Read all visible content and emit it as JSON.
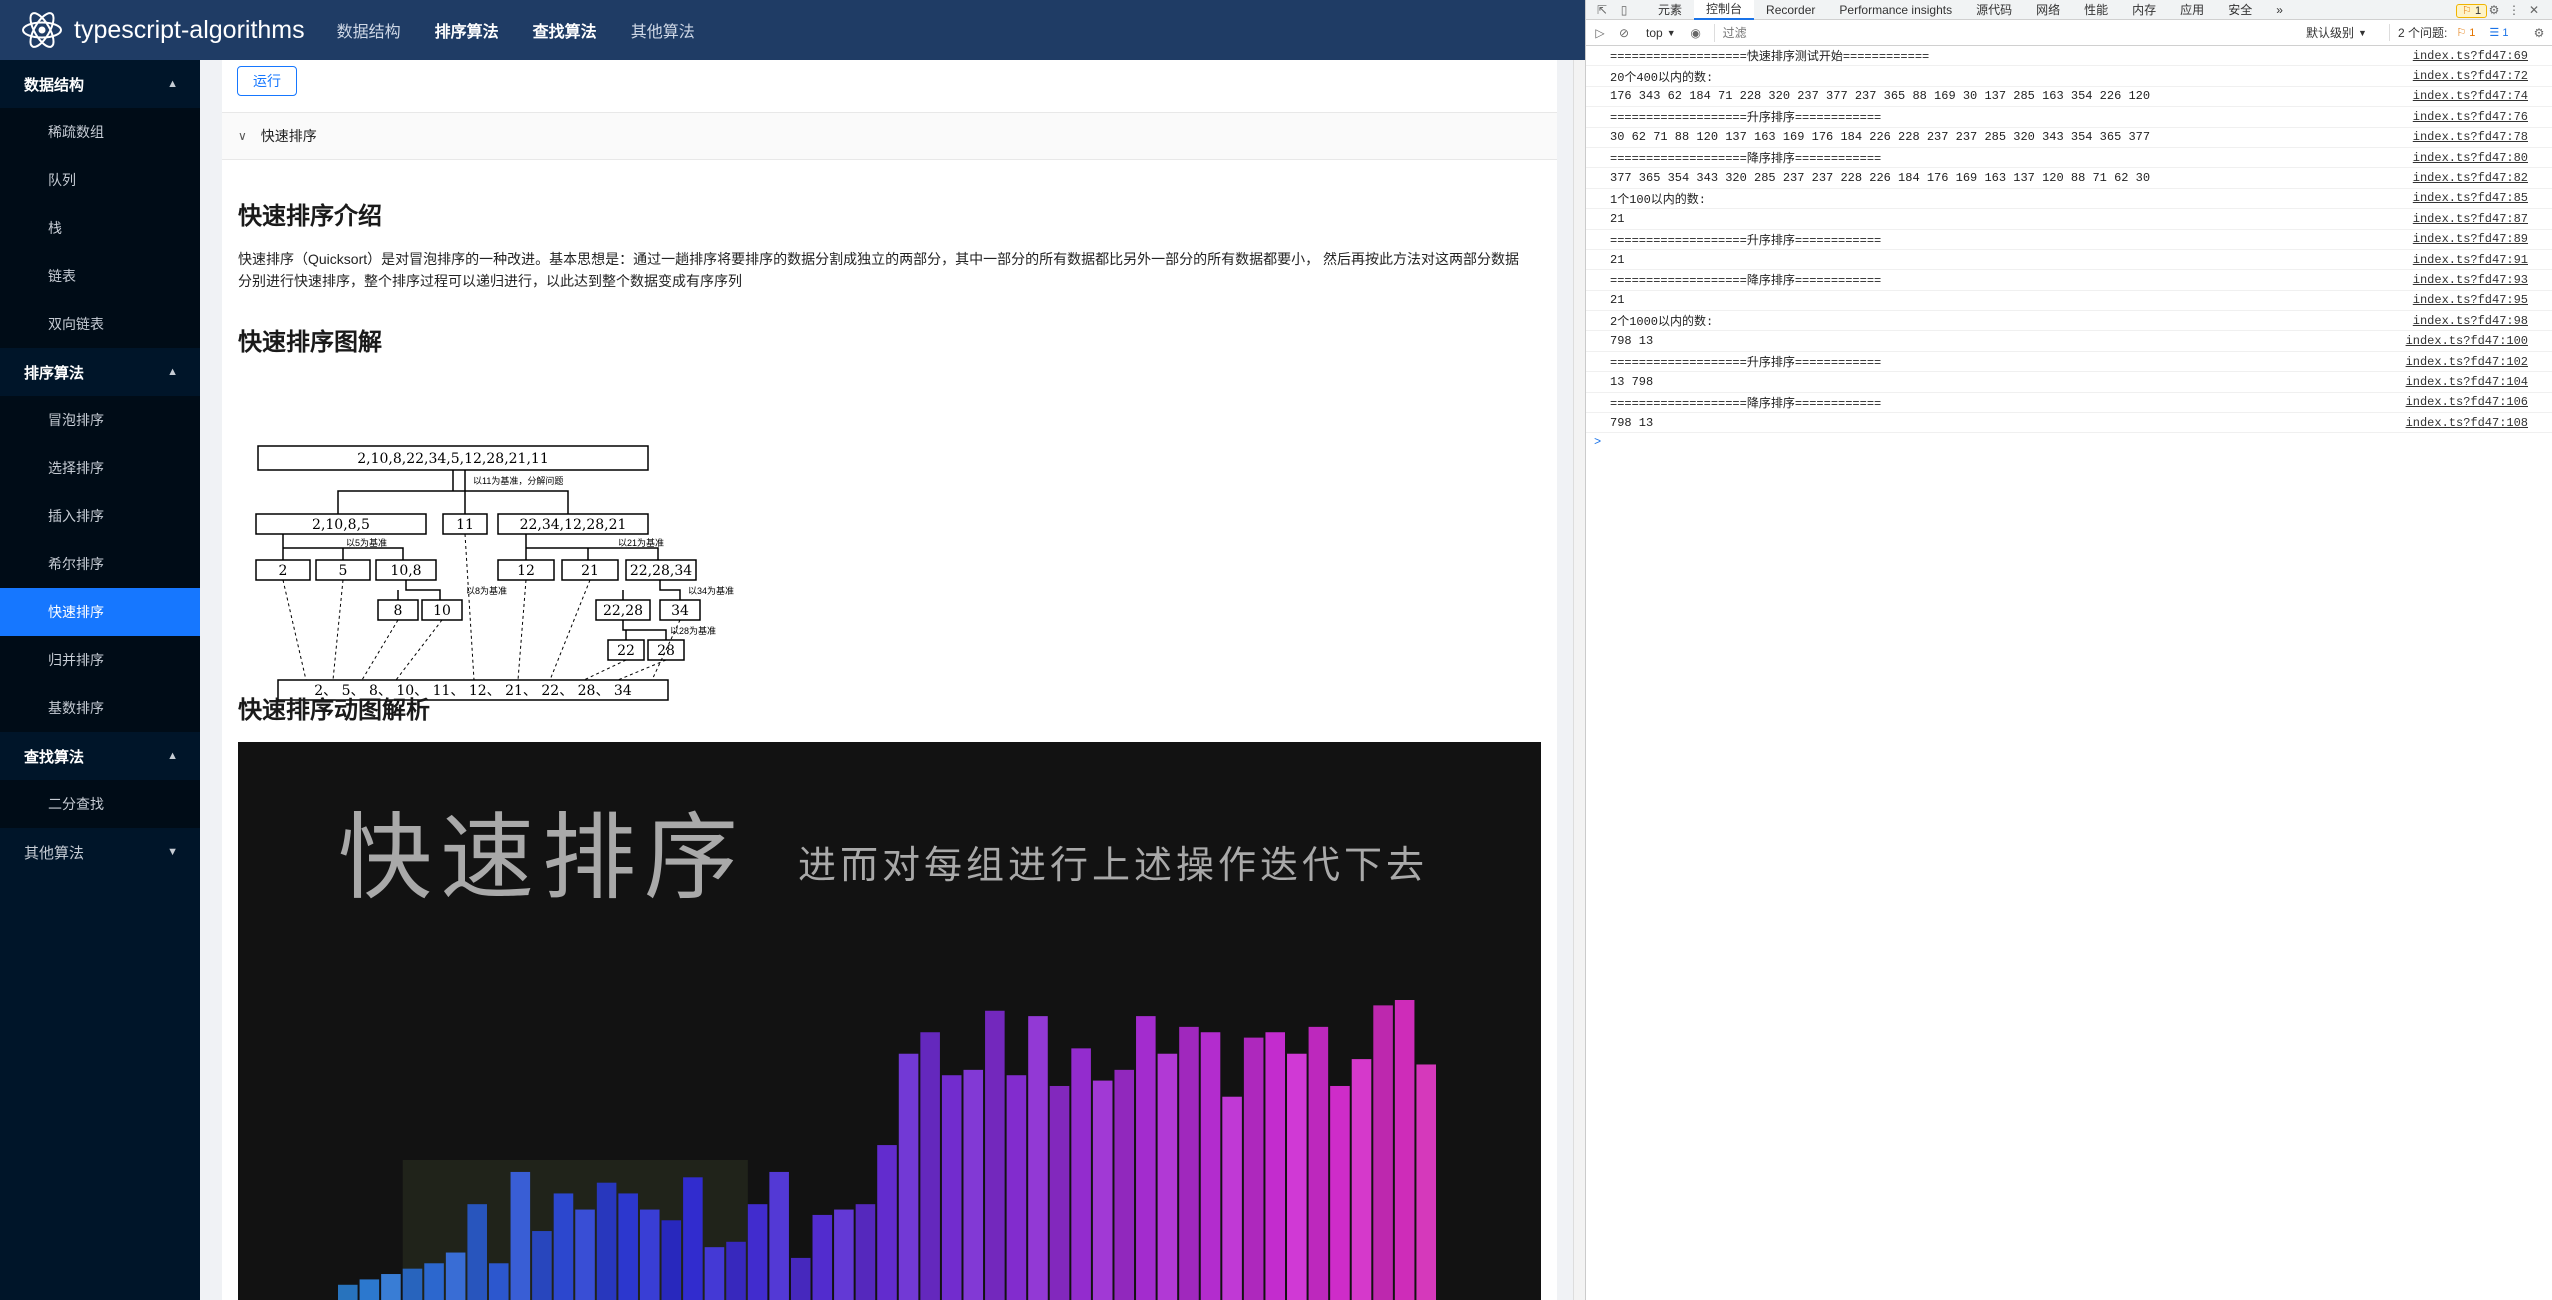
{
  "app": {
    "brand": "typescript-algorithms",
    "menu": [
      "数据结构",
      "排序算法",
      "查找算法",
      "其他算法"
    ]
  },
  "sidebar": {
    "groups": [
      {
        "label": "数据结构",
        "items": [
          "稀疏数组",
          "队列",
          "栈",
          "链表",
          "双向链表"
        ]
      },
      {
        "label": "排序算法",
        "items": [
          "冒泡排序",
          "选择排序",
          "插入排序",
          "希尔排序",
          "快速排序",
          "归并排序",
          "基数排序"
        ]
      },
      {
        "label": "查找算法",
        "items": [
          "二分查找"
        ]
      },
      {
        "label": "其他算法",
        "items": []
      }
    ],
    "active_item": "快速排序"
  },
  "content": {
    "run_button": "运行",
    "collapse_label": "快速排序",
    "intro_heading": "快速排序介绍",
    "intro_text": "快速排序（Quicksort）是对冒泡排序的一种改进。基本思想是：通过一趟排序将要排序的数据分割成独立的两部分，其中一部分的所有数据都比另外一部分的所有数据都要小， 然后再按此方法对这两部分数据分别进行快速排序，整个排序过程可以递归进行，以此达到整个数据变成有序序列",
    "diagram_heading": "快速排序图解",
    "animation_heading": "快速排序动图解析",
    "diagram": {
      "root": "2,10,8,22,34,5,12,28,21,11",
      "note_root": "以11为基准，分解问题",
      "left": "2,10,8,5",
      "pivot": "11",
      "right": "22,34,12,28,21",
      "note_left": "以5为基准",
      "note_right": "以21为基准",
      "l2": [
        "2",
        "5",
        "10,8"
      ],
      "r2": [
        "12",
        "21",
        "22,28,34"
      ],
      "note_8": "以8为基准",
      "note_34": "以34为基准",
      "l3": [
        "8",
        "10"
      ],
      "r3": [
        "22,28",
        "34"
      ],
      "note_28": "以28为基准",
      "r4": [
        "22",
        "28"
      ],
      "result": "2、 5、 8、 10、   11、 12、 21、 22、 28、 34"
    },
    "animation": {
      "title": "快速排序",
      "subtitle": "进而对每组进行上述操作迭代下去",
      "bars": [
        14,
        15,
        16,
        17,
        18,
        20,
        29,
        18,
        35,
        24,
        31,
        28,
        33,
        31,
        28,
        26,
        34,
        21,
        22,
        29,
        35,
        19,
        27,
        28,
        29,
        40,
        57,
        61,
        53,
        54,
        65,
        53,
        64,
        51,
        58,
        52,
        54,
        64,
        57,
        62,
        61,
        49,
        60,
        61,
        57,
        62,
        51,
        56,
        66,
        67,
        55
      ]
    }
  },
  "devtools": {
    "tabs": [
      "元素",
      "控制台",
      "Recorder",
      "Performance insights",
      "源代码",
      "网络",
      "性能",
      "内存",
      "应用",
      "安全",
      "»"
    ],
    "active_tab": "控制台",
    "warning_count": "1",
    "context": "top",
    "filter_placeholder": "过滤",
    "level": "默认级别",
    "issues_label": "2 个问题:",
    "issues_warn": "1",
    "issues_info": "1",
    "logs": [
      {
        "text": "===================快速排序测试开始============",
        "src": "index.ts?fd47:69"
      },
      {
        "text": "20个400以内的数:",
        "src": "index.ts?fd47:72"
      },
      {
        "text": "176 343 62 184 71 228 320 237 377 237 365 88 169 30 137 285 163 354 226 120",
        "src": "index.ts?fd47:74"
      },
      {
        "text": "===================升序排序============",
        "src": "index.ts?fd47:76"
      },
      {
        "text": "30 62 71 88 120 137 163 169 176 184 226 228 237 237 285 320 343 354 365 377",
        "src": "index.ts?fd47:78"
      },
      {
        "text": "===================降序排序============",
        "src": "index.ts?fd47:80"
      },
      {
        "text": "377 365 354 343 320 285 237 237 228 226 184 176 169 163 137 120 88 71 62 30",
        "src": "index.ts?fd47:82"
      },
      {
        "text": "1个100以内的数:",
        "src": "index.ts?fd47:85"
      },
      {
        "text": "21",
        "src": "index.ts?fd47:87"
      },
      {
        "text": "===================升序排序============",
        "src": "index.ts?fd47:89"
      },
      {
        "text": "21",
        "src": "index.ts?fd47:91"
      },
      {
        "text": "===================降序排序============",
        "src": "index.ts?fd47:93"
      },
      {
        "text": "21",
        "src": "index.ts?fd47:95"
      },
      {
        "text": "2个1000以内的数:",
        "src": "index.ts?fd47:98"
      },
      {
        "text": "798 13",
        "src": "index.ts?fd47:100"
      },
      {
        "text": "===================升序排序============",
        "src": "index.ts?fd47:102"
      },
      {
        "text": "13 798",
        "src": "index.ts?fd47:104"
      },
      {
        "text": "===================降序排序============",
        "src": "index.ts?fd47:106"
      },
      {
        "text": "798 13",
        "src": "index.ts?fd47:108"
      }
    ],
    "prompt": ">"
  }
}
